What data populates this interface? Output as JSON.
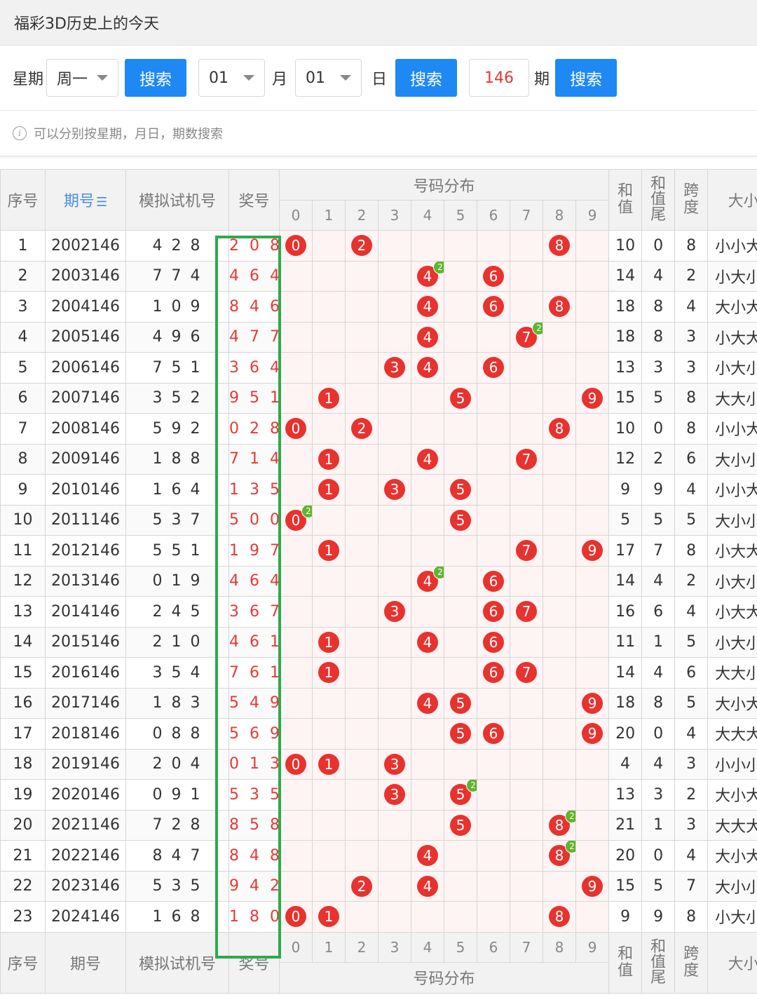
{
  "title": "福彩3D历史上的今天",
  "search": {
    "weekday_label": "星期",
    "weekday_value": "周一",
    "search_label": "搜索",
    "month_value": "01",
    "month_label": "月",
    "day_value": "01",
    "day_label": "日",
    "period_value": "146",
    "period_label": "期"
  },
  "tip": "可以分别按星期，月日，期数搜索",
  "table": {
    "headers": {
      "index": "序号",
      "period": "期号",
      "sim": "模拟试机号",
      "win": "奖号",
      "dist": "号码分布",
      "sum": "和值",
      "sumtail": "和值尾",
      "span": "跨度",
      "size": "大小"
    },
    "digits": [
      "0",
      "1",
      "2",
      "3",
      "4",
      "5",
      "6",
      "7",
      "8",
      "9"
    ],
    "rows": [
      {
        "idx": "1",
        "period": "2002146",
        "sim": "4 2 8",
        "win": "2 0 8",
        "balls": [
          0,
          2,
          8
        ],
        "rep": null,
        "sum": "10",
        "tail": "0",
        "span": "8",
        "size": "小小大"
      },
      {
        "idx": "2",
        "period": "2003146",
        "sim": "7 7 4",
        "win": "4 6 4",
        "balls": [
          4,
          6
        ],
        "rep": 4,
        "sum": "14",
        "tail": "4",
        "span": "2",
        "size": "小大小"
      },
      {
        "idx": "3",
        "period": "2004146",
        "sim": "1 0 9",
        "win": "8 4 6",
        "balls": [
          4,
          6,
          8
        ],
        "rep": null,
        "sum": "18",
        "tail": "8",
        "span": "4",
        "size": "大小大"
      },
      {
        "idx": "4",
        "period": "2005146",
        "sim": "4 9 6",
        "win": "4 7 7",
        "balls": [
          4,
          7
        ],
        "rep": 7,
        "sum": "18",
        "tail": "8",
        "span": "3",
        "size": "小大大"
      },
      {
        "idx": "5",
        "period": "2006146",
        "sim": "7 5 1",
        "win": "3 6 4",
        "balls": [
          3,
          4,
          6
        ],
        "rep": null,
        "sum": "13",
        "tail": "3",
        "span": "3",
        "size": "小大小"
      },
      {
        "idx": "6",
        "period": "2007146",
        "sim": "3 5 2",
        "win": "9 5 1",
        "balls": [
          1,
          5,
          9
        ],
        "rep": null,
        "sum": "15",
        "tail": "5",
        "span": "8",
        "size": "大大小"
      },
      {
        "idx": "7",
        "period": "2008146",
        "sim": "5 9 2",
        "win": "0 2 8",
        "balls": [
          0,
          2,
          8
        ],
        "rep": null,
        "sum": "10",
        "tail": "0",
        "span": "8",
        "size": "小小大"
      },
      {
        "idx": "8",
        "period": "2009146",
        "sim": "1 8 8",
        "win": "7 1 4",
        "balls": [
          1,
          4,
          7
        ],
        "rep": null,
        "sum": "12",
        "tail": "2",
        "span": "6",
        "size": "大小小"
      },
      {
        "idx": "9",
        "period": "2010146",
        "sim": "1 6 4",
        "win": "1 3 5",
        "balls": [
          1,
          3,
          5
        ],
        "rep": null,
        "sum": "9",
        "tail": "9",
        "span": "4",
        "size": "小小大"
      },
      {
        "idx": "10",
        "period": "2011146",
        "sim": "5 3 7",
        "win": "5 0 0",
        "balls": [
          0,
          5
        ],
        "rep": 0,
        "sum": "5",
        "tail": "5",
        "span": "5",
        "size": "大小小"
      },
      {
        "idx": "11",
        "period": "2012146",
        "sim": "5 5 1",
        "win": "1 9 7",
        "balls": [
          1,
          7,
          9
        ],
        "rep": null,
        "sum": "17",
        "tail": "7",
        "span": "8",
        "size": "小大大"
      },
      {
        "idx": "12",
        "period": "2013146",
        "sim": "0 1 9",
        "win": "4 6 4",
        "balls": [
          4,
          6
        ],
        "rep": 4,
        "sum": "14",
        "tail": "4",
        "span": "2",
        "size": "小大小"
      },
      {
        "idx": "13",
        "period": "2014146",
        "sim": "2 4 5",
        "win": "3 6 7",
        "balls": [
          3,
          6,
          7
        ],
        "rep": null,
        "sum": "16",
        "tail": "6",
        "span": "4",
        "size": "小大大"
      },
      {
        "idx": "14",
        "period": "2015146",
        "sim": "2 1 0",
        "win": "4 6 1",
        "balls": [
          1,
          4,
          6
        ],
        "rep": null,
        "sum": "11",
        "tail": "1",
        "span": "5",
        "size": "小大小"
      },
      {
        "idx": "15",
        "period": "2016146",
        "sim": "3 5 4",
        "win": "7 6 1",
        "balls": [
          1,
          6,
          7
        ],
        "rep": null,
        "sum": "14",
        "tail": "4",
        "span": "6",
        "size": "大大小"
      },
      {
        "idx": "16",
        "period": "2017146",
        "sim": "1 8 3",
        "win": "5 4 9",
        "balls": [
          4,
          5,
          9
        ],
        "rep": null,
        "sum": "18",
        "tail": "8",
        "span": "5",
        "size": "大小大"
      },
      {
        "idx": "17",
        "period": "2018146",
        "sim": "0 8 8",
        "win": "5 6 9",
        "balls": [
          5,
          6,
          9
        ],
        "rep": null,
        "sum": "20",
        "tail": "0",
        "span": "4",
        "size": "大大大"
      },
      {
        "idx": "18",
        "period": "2019146",
        "sim": "2 0 4",
        "win": "0 1 3",
        "balls": [
          0,
          1,
          3
        ],
        "rep": null,
        "sum": "4",
        "tail": "4",
        "span": "3",
        "size": "小小小"
      },
      {
        "idx": "19",
        "period": "2020146",
        "sim": "0 9 1",
        "win": "5 3 5",
        "balls": [
          3,
          5
        ],
        "rep": 5,
        "sum": "13",
        "tail": "3",
        "span": "2",
        "size": "大小大"
      },
      {
        "idx": "20",
        "period": "2021146",
        "sim": "7 2 8",
        "win": "8 5 8",
        "balls": [
          5,
          8
        ],
        "rep": 8,
        "sum": "21",
        "tail": "1",
        "span": "3",
        "size": "大大大"
      },
      {
        "idx": "21",
        "period": "2022146",
        "sim": "8 4 7",
        "win": "8 4 8",
        "balls": [
          4,
          8
        ],
        "rep": 8,
        "sum": "20",
        "tail": "0",
        "span": "4",
        "size": "大小大"
      },
      {
        "idx": "22",
        "period": "2023146",
        "sim": "5 3 5",
        "win": "9 4 2",
        "balls": [
          2,
          4,
          9
        ],
        "rep": null,
        "sum": "15",
        "tail": "5",
        "span": "7",
        "size": "大小小"
      },
      {
        "idx": "23",
        "period": "2024146",
        "sim": "1 6 8",
        "win": "1 8 0",
        "balls": [
          0,
          1,
          8
        ],
        "rep": null,
        "sum": "9",
        "tail": "9",
        "span": "8",
        "size": "小大小"
      }
    ]
  },
  "colors": {
    "ball": "#e8322e",
    "repeat_badge": "#5fb52b",
    "button": "#1e88f5",
    "highlight_box": "#2eaa4a",
    "win_text": "#e53935"
  }
}
